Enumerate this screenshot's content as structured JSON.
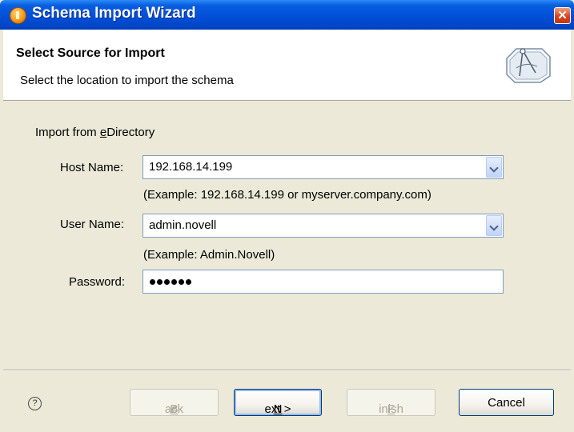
{
  "window": {
    "title": "Schema Import Wizard",
    "close_glyph": "✕"
  },
  "header": {
    "title": "Select Source for Import",
    "description": "Select the location to import the schema",
    "icon": "schema-import-wizard-icon"
  },
  "form": {
    "section_label_pre": "Import from ",
    "section_label_accel": "e",
    "section_label_post": "Directory",
    "host": {
      "label": "Host Name:",
      "value": "192.168.14.199",
      "hint": "(Example: 192.168.14.199 or myserver.company.com)"
    },
    "user": {
      "label": "User Name:",
      "value": "admin.novell",
      "hint": "(Example:  Admin.Novell)"
    },
    "password": {
      "label": "Password:",
      "masked_length": 6
    }
  },
  "footer": {
    "help_glyph": "?",
    "buttons": {
      "back": {
        "pre": "< ",
        "accel": "B",
        "post": "ack",
        "enabled": false
      },
      "next": {
        "pre": "",
        "accel": "N",
        "post": "ext >",
        "enabled": true
      },
      "finish": {
        "pre": "",
        "accel": "F",
        "post": "inish",
        "enabled": false
      },
      "cancel": {
        "label": "Cancel",
        "enabled": true
      }
    }
  }
}
